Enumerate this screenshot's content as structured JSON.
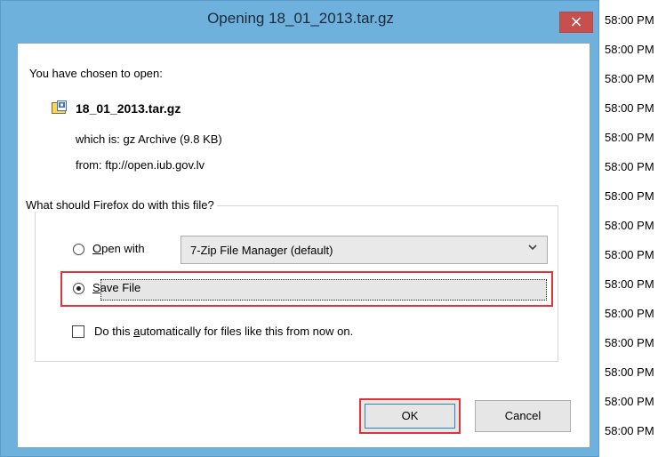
{
  "window": {
    "title": "Opening 18_01_2013.tar.gz",
    "close_glyph": "×"
  },
  "dialog": {
    "intro": "You have chosen to open:",
    "file_name": "18_01_2013.tar.gz",
    "file_icon": "archive-file-icon",
    "which_is_label": "which is:",
    "which_is_value": "gz Archive (9.8 KB)",
    "from_label": "from:",
    "from_value": "ftp://open.iub.gov.lv"
  },
  "action_group": {
    "legend": "What should Firefox do with this file?",
    "open_with": {
      "label_mnemonic": "O",
      "label_rest": "pen with",
      "checked": false
    },
    "app_select": {
      "selected": "7-Zip File Manager (default)",
      "chevron_icon": "chevron-down-icon"
    },
    "save_file": {
      "label_mnemonic": "S",
      "label_rest": "ave File",
      "checked": true
    },
    "auto_checkbox": {
      "label_before": "Do this ",
      "label_mnemonic": "a",
      "label_after": "utomatically for files like this from now on.",
      "checked": false
    }
  },
  "buttons": {
    "ok": "OK",
    "cancel": "Cancel"
  },
  "background": {
    "times": [
      "58:00 PM",
      "58:00 PM",
      "58:00 PM",
      "58:00 PM",
      "58:00 PM",
      "58:00 PM",
      "58:00 PM",
      "58:00 PM",
      "58:00 PM",
      "58:00 PM",
      "58:00 PM",
      "58:00 PM",
      "58:00 PM",
      "58:00 PM",
      "58:00 PM"
    ]
  },
  "colors": {
    "titlebar": "#6fb1dd",
    "close": "#c7504f",
    "highlight": "#e0333a"
  }
}
